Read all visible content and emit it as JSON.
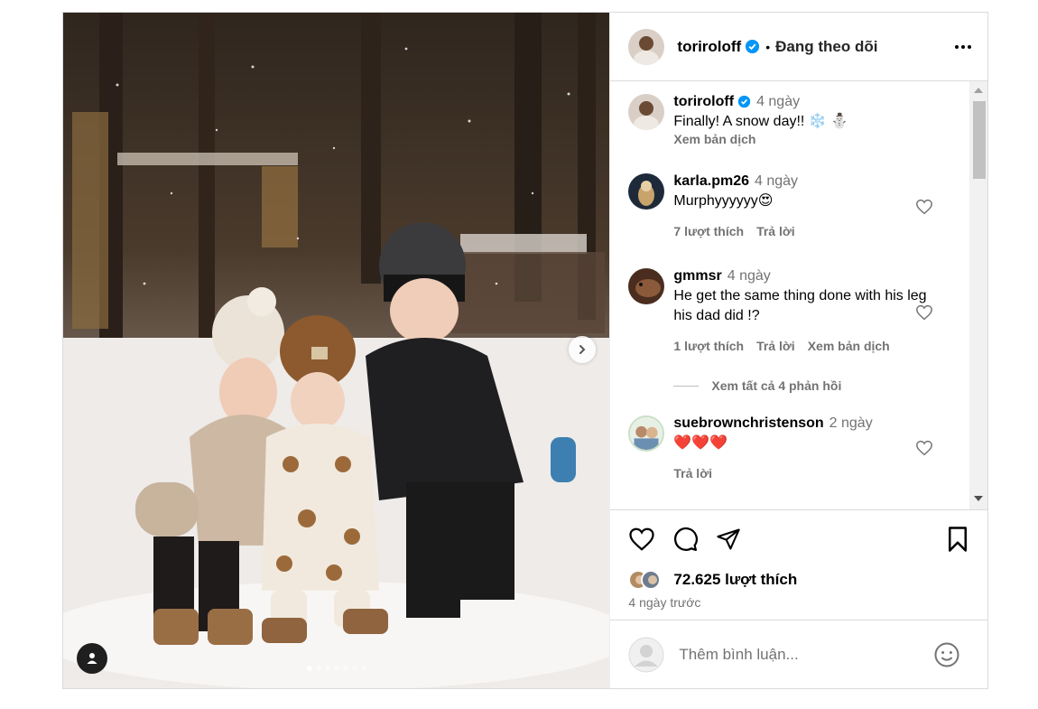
{
  "header": {
    "username": "toriroloff",
    "separator": "•",
    "follow_status": "Đang theo dõi",
    "icons": {
      "verified": "verified-badge-icon",
      "more": "more-options-icon"
    }
  },
  "photo": {
    "carousel": {
      "total": 7,
      "active_index": 0
    },
    "icons": {
      "next": "chevron-right-icon",
      "tagged": "user-tag-icon"
    }
  },
  "caption": {
    "username": "toriroloff",
    "time": "4 ngày",
    "text": "Finally! A snow day!! ❄️ ⛄",
    "translate": "Xem bản dịch"
  },
  "comments": [
    {
      "username": "karla.pm26",
      "time": "4 ngày",
      "text": "Murphyyyyyy😍",
      "likes": "7 lượt thích",
      "reply": "Trả lời",
      "translate": ""
    },
    {
      "username": "gmmsr",
      "time": "4 ngày",
      "text": "He get the same thing done with his leg his dad did !?",
      "likes": "1 lượt thích",
      "reply": "Trả lời",
      "translate": "Xem bản dịch"
    },
    {
      "username": "suebrownchristenson",
      "time": "2 ngày",
      "text": "❤️❤️❤️",
      "likes": "",
      "reply": "Trả lời",
      "translate": ""
    }
  ],
  "view_replies": "Xem tất cả 4 phản hồi",
  "actions": {
    "icons": {
      "like": "heart-icon",
      "comment": "comment-bubble-icon",
      "share": "share-plane-icon",
      "save": "bookmark-icon"
    }
  },
  "likes": {
    "count_text": "72.625 lượt thích"
  },
  "posted": "4 ngày trước",
  "add_comment": {
    "placeholder": "Thêm bình luận...",
    "icon": "emoji-icon"
  },
  "colors": {
    "verified": "#0095f6",
    "muted": "#737373",
    "border": "#dbdbdb"
  }
}
